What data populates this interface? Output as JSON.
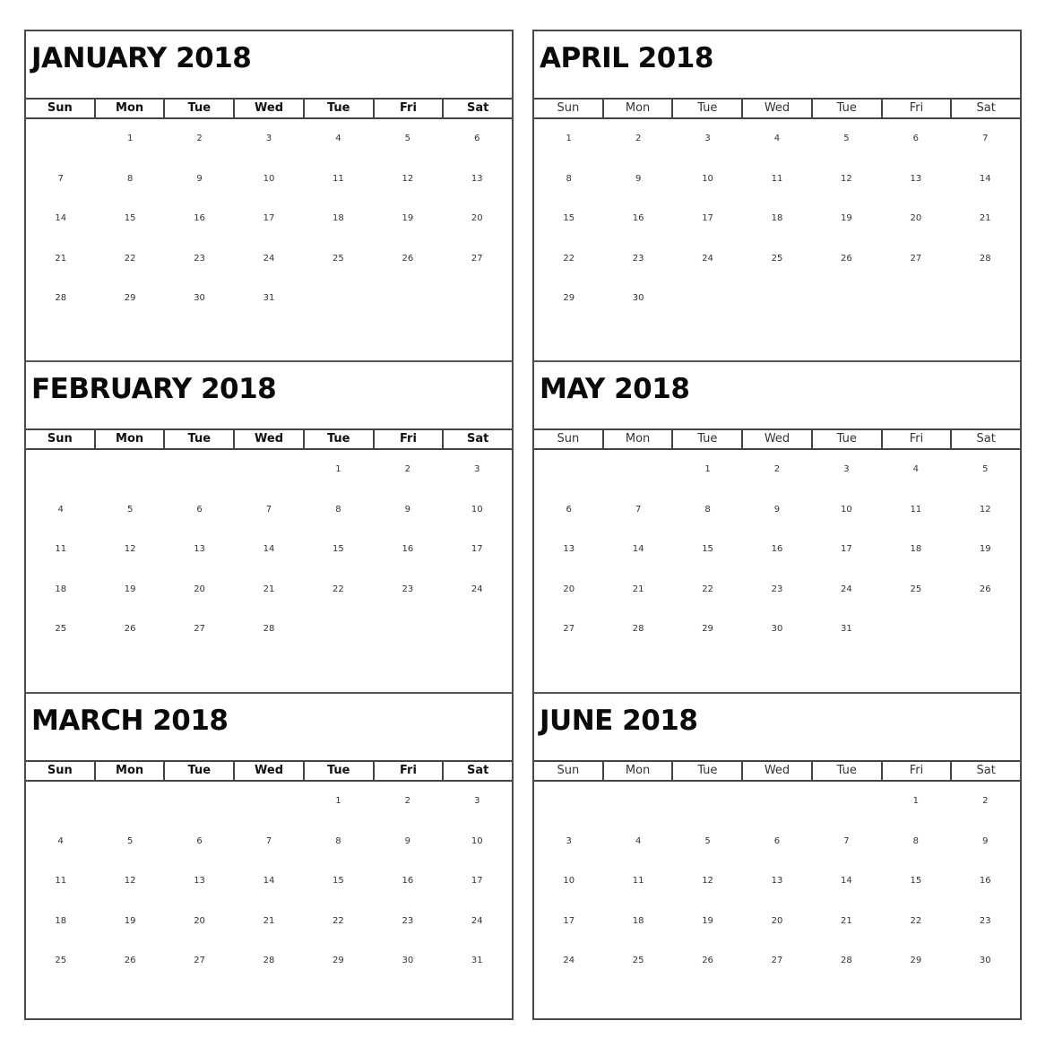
{
  "weekday_labels": [
    "Sun",
    "Mon",
    "Tue",
    "Wed",
    "Tue",
    "Fri",
    "Sat"
  ],
  "columns": [
    {
      "months": [
        {
          "title": "JANUARY 2018",
          "leading_blanks": 1,
          "days": [
            1,
            2,
            3,
            4,
            5,
            6,
            7,
            8,
            9,
            10,
            11,
            12,
            13,
            14,
            15,
            16,
            17,
            18,
            19,
            20,
            21,
            22,
            23,
            24,
            25,
            26,
            27,
            28,
            29,
            30,
            31
          ]
        },
        {
          "title": "FEBRUARY 2018",
          "leading_blanks": 4,
          "days": [
            1,
            2,
            3,
            4,
            5,
            6,
            7,
            8,
            9,
            10,
            11,
            12,
            13,
            14,
            15,
            16,
            17,
            18,
            19,
            20,
            21,
            22,
            23,
            24,
            25,
            26,
            27,
            28
          ]
        },
        {
          "title": "MARCH 2018",
          "leading_blanks": 4,
          "days": [
            1,
            2,
            3,
            4,
            5,
            6,
            7,
            8,
            9,
            10,
            11,
            12,
            13,
            14,
            15,
            16,
            17,
            18,
            19,
            20,
            21,
            22,
            23,
            24,
            25,
            26,
            27,
            28,
            29,
            30,
            31
          ]
        }
      ]
    },
    {
      "months": [
        {
          "title": "APRIL 2018",
          "leading_blanks": 0,
          "days": [
            1,
            2,
            3,
            4,
            5,
            6,
            7,
            8,
            9,
            10,
            11,
            12,
            13,
            14,
            15,
            16,
            17,
            18,
            19,
            20,
            21,
            22,
            23,
            24,
            25,
            26,
            27,
            28,
            29,
            30
          ]
        },
        {
          "title": "MAY 2018",
          "leading_blanks": 2,
          "days": [
            1,
            2,
            3,
            4,
            5,
            6,
            7,
            8,
            9,
            10,
            11,
            12,
            13,
            14,
            15,
            16,
            17,
            18,
            19,
            20,
            21,
            22,
            23,
            24,
            25,
            26,
            27,
            28,
            29,
            30,
            31
          ]
        },
        {
          "title": "JUNE 2018",
          "leading_blanks": 5,
          "days": [
            1,
            2,
            3,
            4,
            5,
            6,
            7,
            8,
            9,
            10,
            11,
            12,
            13,
            14,
            15,
            16,
            17,
            18,
            19,
            20,
            21,
            22,
            23,
            24,
            25,
            26,
            27,
            28,
            29,
            30
          ]
        }
      ]
    }
  ]
}
